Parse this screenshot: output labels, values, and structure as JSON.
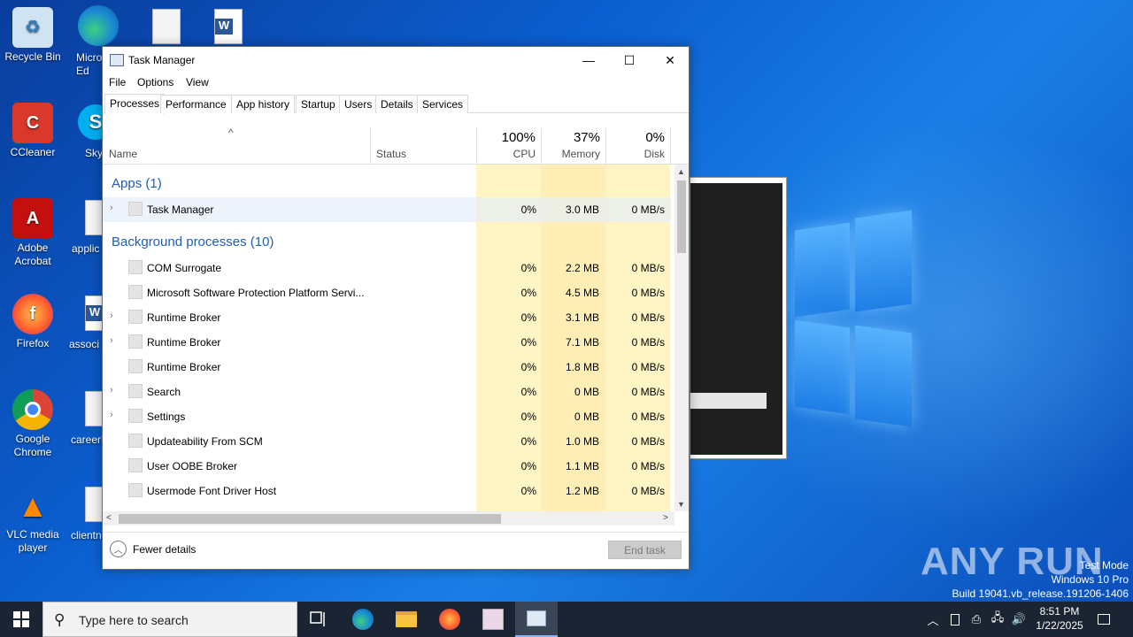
{
  "desktop": {
    "icons": [
      {
        "label": "Recycle Bin",
        "icon": "recycle-bin-icon"
      },
      {
        "label": "CCleaner",
        "icon": "ccleaner-icon"
      },
      {
        "label": "Adobe Acrobat",
        "icon": "adobe-acrobat-icon"
      },
      {
        "label": "Firefox",
        "icon": "firefox-icon"
      },
      {
        "label": "Google Chrome",
        "icon": "chrome-icon"
      },
      {
        "label": "VLC media player",
        "icon": "vlc-icon"
      }
    ],
    "partial_icons": [
      {
        "label": "Micro Ed",
        "icon": "edge-icon"
      },
      {
        "label": "Sky",
        "icon": "skype-icon"
      },
      {
        "label": "applic",
        "icon": "file-icon"
      },
      {
        "label": "associ",
        "icon": "word-icon"
      },
      {
        "label": "careerb",
        "icon": "file-icon"
      },
      {
        "label": "clientn",
        "icon": "file-icon"
      }
    ],
    "watermark": "ANY RUN",
    "test_mode": [
      "Test Mode",
      "Windows 10 Pro",
      "Build 19041.vb_release.191206-1406"
    ]
  },
  "window": {
    "title": "Task Manager",
    "controls": {
      "minimize": "—",
      "maximize": "☐",
      "close": "✕"
    },
    "menu": [
      "File",
      "Options",
      "View"
    ],
    "tabs": [
      "Processes",
      "Performance",
      "App history",
      "Startup",
      "Users",
      "Details",
      "Services"
    ],
    "active_tab": "Processes",
    "columns": {
      "name": "Name",
      "status": "Status",
      "cpu": {
        "label": "CPU",
        "percent": "100%"
      },
      "memory": {
        "label": "Memory",
        "percent": "37%"
      },
      "disk": {
        "label": "Disk",
        "percent": "0%"
      }
    },
    "sections": {
      "apps": "Apps (1)",
      "background": "Background processes (10)"
    },
    "apps": [
      {
        "name": "Task Manager",
        "cpu": "0%",
        "memory": "3.0 MB",
        "disk": "0 MB/s",
        "expandable": true
      }
    ],
    "background": [
      {
        "name": "COM Surrogate",
        "cpu": "0%",
        "memory": "2.2 MB",
        "disk": "0 MB/s",
        "expandable": false
      },
      {
        "name": "Microsoft Software Protection Platform Servi...",
        "cpu": "0%",
        "memory": "4.5 MB",
        "disk": "0 MB/s",
        "expandable": false
      },
      {
        "name": "Runtime Broker",
        "cpu": "0%",
        "memory": "3.1 MB",
        "disk": "0 MB/s",
        "expandable": true
      },
      {
        "name": "Runtime Broker",
        "cpu": "0%",
        "memory": "7.1 MB",
        "disk": "0 MB/s",
        "expandable": true
      },
      {
        "name": "Runtime Broker",
        "cpu": "0%",
        "memory": "1.8 MB",
        "disk": "0 MB/s",
        "expandable": false
      },
      {
        "name": "Search",
        "cpu": "0%",
        "memory": "0 MB",
        "disk": "0 MB/s",
        "expandable": true
      },
      {
        "name": "Settings",
        "cpu": "0%",
        "memory": "0 MB",
        "disk": "0 MB/s",
        "expandable": true
      },
      {
        "name": "Updateability From SCM",
        "cpu": "0%",
        "memory": "1.0 MB",
        "disk": "0 MB/s",
        "expandable": false
      },
      {
        "name": "User OOBE Broker",
        "cpu": "0%",
        "memory": "1.1 MB",
        "disk": "0 MB/s",
        "expandable": false
      },
      {
        "name": "Usermode Font Driver Host",
        "cpu": "0%",
        "memory": "1.2 MB",
        "disk": "0 MB/s",
        "expandable": false
      }
    ],
    "footer": {
      "fewer_details": "Fewer details",
      "end_task": "End task"
    }
  },
  "taskbar": {
    "search_placeholder": "Type here to search",
    "pinned": [
      "task-view-icon",
      "edge-icon",
      "file-explorer-icon",
      "firefox-icon",
      "app-icon",
      "task-manager-icon"
    ],
    "clock": {
      "time": "8:51 PM",
      "date": "1/22/2025"
    }
  },
  "colors": {
    "cpu_heat": "#fff4c4",
    "memory_heat": "#ffe9a8",
    "section_blue": "#1f5fb3",
    "taskbar": "#1a2433"
  }
}
